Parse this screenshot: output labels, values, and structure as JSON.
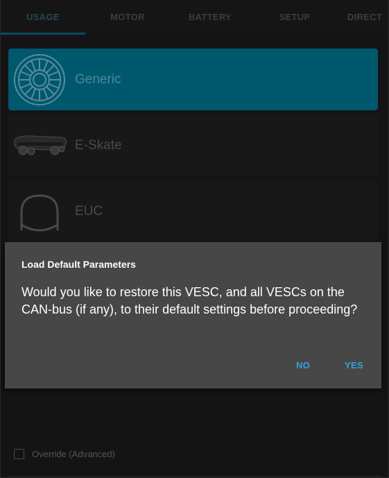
{
  "tabs": [
    {
      "label": "USAGE",
      "active": true
    },
    {
      "label": "MOTOR",
      "active": false
    },
    {
      "label": "BATTERY",
      "active": false
    },
    {
      "label": "SETUP",
      "active": false
    },
    {
      "label": "DIRECT",
      "active": false
    }
  ],
  "usage_cards": [
    {
      "label": "Generic",
      "icon": "motor-wheel-icon",
      "selected": true
    },
    {
      "label": "E-Skate",
      "icon": "eskate-board-icon",
      "selected": false
    },
    {
      "label": "EUC",
      "icon": "euc-wheel-icon",
      "selected": false
    }
  ],
  "override": {
    "label": "Override (Advanced)",
    "checked": false
  },
  "dialog": {
    "title": "Load Default Parameters",
    "message": "Would you like to restore this VESC, and all VESCs on the CAN-bus (if any), to their default settings before proceeding?",
    "no_label": "NO",
    "yes_label": "YES"
  },
  "colors": {
    "background": "#141414",
    "accent": "#00586f",
    "dialog_bg": "#474747",
    "dialog_button": "#2aa7dc"
  }
}
